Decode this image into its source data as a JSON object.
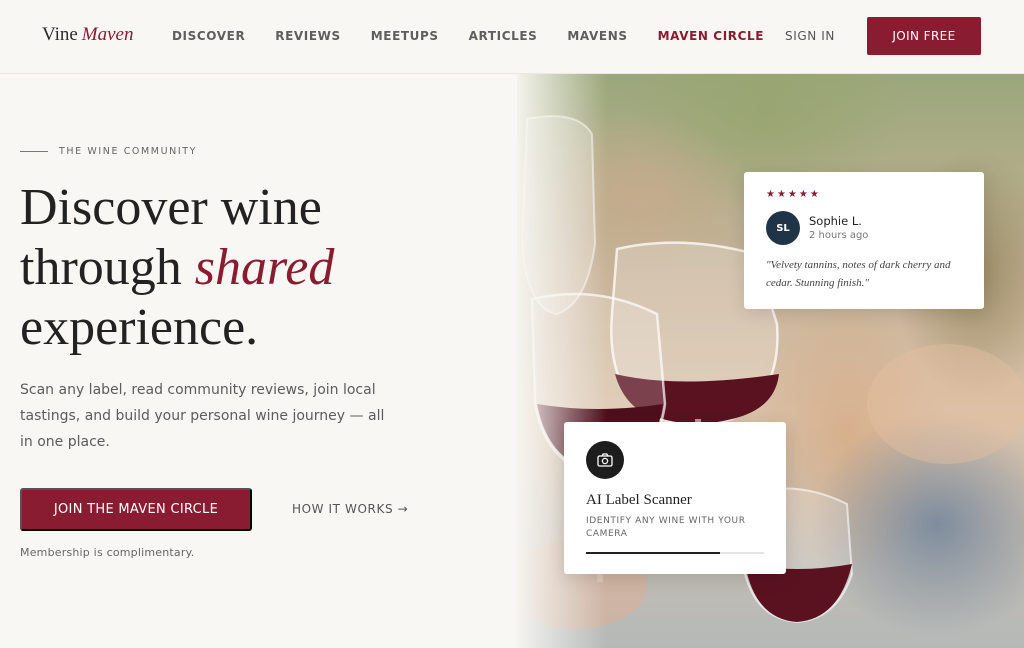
{
  "brand": {
    "name": "Vine",
    "accent": "Maven"
  },
  "nav": {
    "items": [
      {
        "label": "DISCOVER",
        "active": false
      },
      {
        "label": "REVIEWS",
        "active": false
      },
      {
        "label": "MEETUPS",
        "active": false
      },
      {
        "label": "ARTICLES",
        "active": false
      },
      {
        "label": "MAVENS",
        "active": false
      },
      {
        "label": "MAVEN CIRCLE",
        "active": true
      }
    ],
    "signin": "SIGN IN",
    "join": "JOIN FREE"
  },
  "hero": {
    "eyebrow": "THE WINE COMMUNITY",
    "headline_1": "Discover wine",
    "headline_2a": "through ",
    "headline_2b": "shared",
    "headline_3": "experience.",
    "subtext": "Scan any label, read community reviews, join local tastings, and build your personal wine journey — all in one place.",
    "cta": "JOIN THE MAVEN CIRCLE",
    "secondary": "HOW IT WORKS →",
    "note": "Membership is complimentary."
  },
  "review": {
    "stars": "★★★★★",
    "rating": 5,
    "initials": "SL",
    "name": "Sophie L.",
    "time": "2 hours ago",
    "quote": "\"Velvety tannins, notes of dark cherry and cedar. Stunning finish.\""
  },
  "scanner": {
    "icon": "camera-icon",
    "title": "AI Label Scanner",
    "subtitle": "IDENTIFY ANY WINE WITH YOUR CAMERA",
    "progress": 0.75
  },
  "colors": {
    "accent": "#8a1c32",
    "background": "#f8f7f3",
    "avatar": "#1f3547"
  }
}
